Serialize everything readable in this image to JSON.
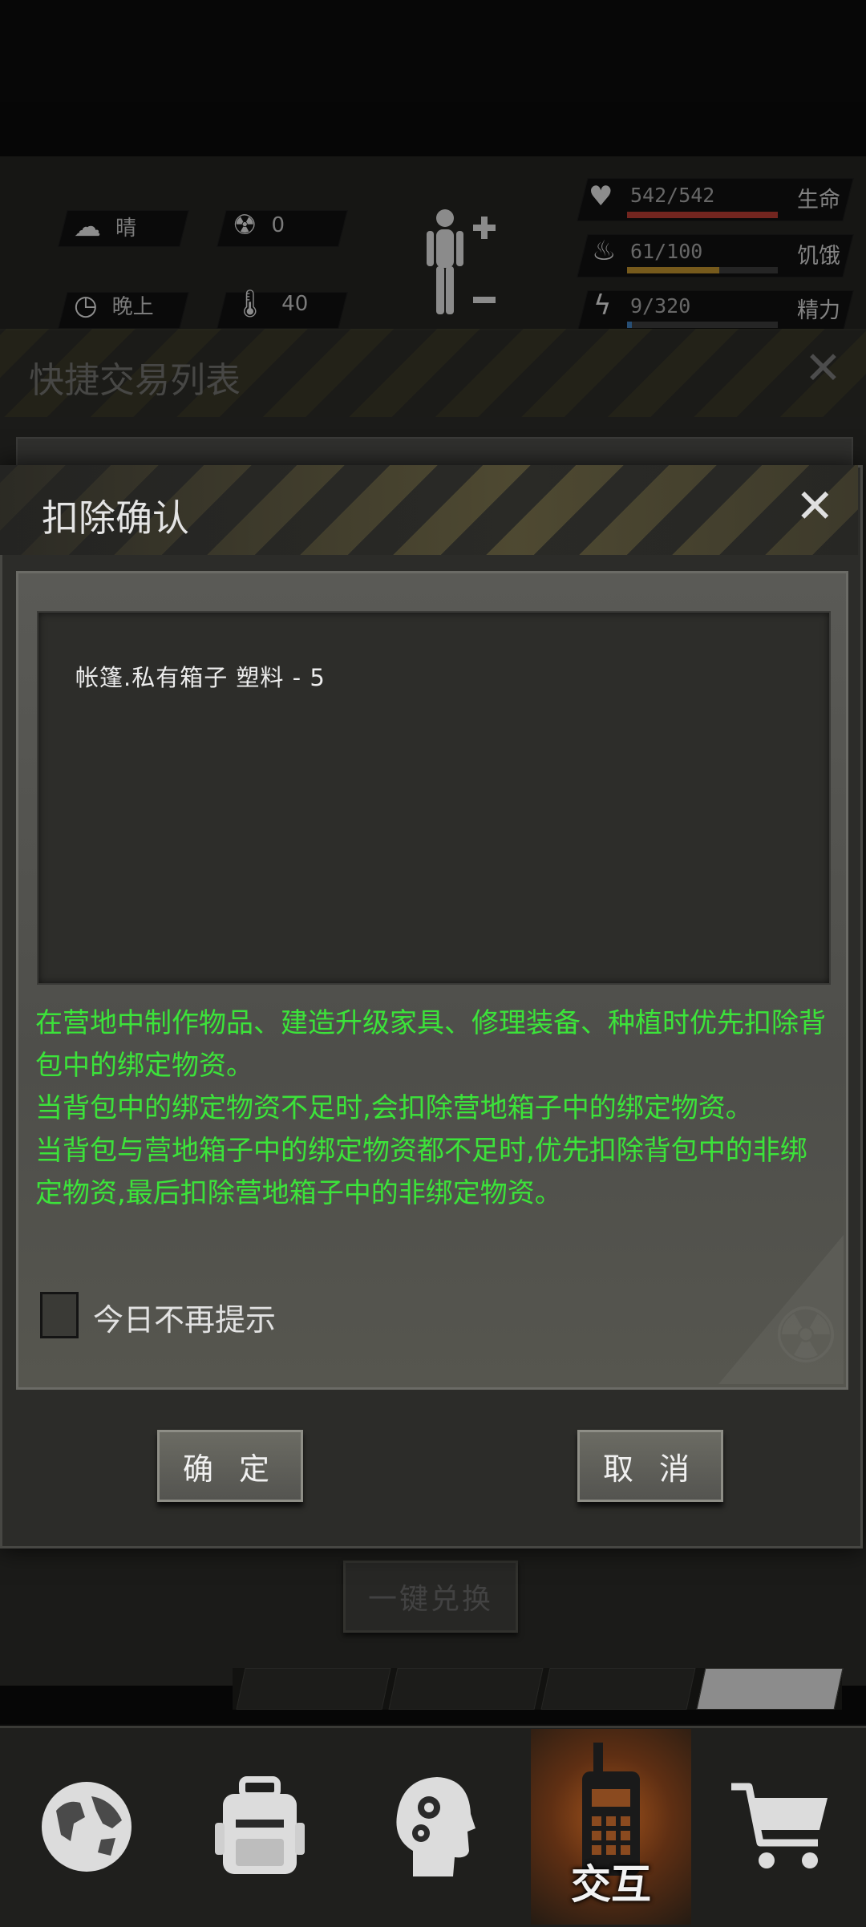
{
  "status": {
    "weather": "晴",
    "radiation": "0",
    "time_of_day": "晚上",
    "temperature": "40",
    "health": {
      "value": "542/542",
      "label": "生命",
      "ratio": 1.0,
      "color": "#b03a31"
    },
    "hunger": {
      "value": "61/100",
      "label": "饥饿",
      "ratio": 0.61,
      "color": "#b58a2c"
    },
    "energy": {
      "value": "9/320",
      "label": "精力",
      "ratio": 0.03,
      "color": "#3c78b3"
    }
  },
  "trade_panel": {
    "title": "快捷交易列表",
    "exchange_button": "一键兑换"
  },
  "dialog": {
    "title": "扣除确认",
    "items_text": "帐篷.私有箱子 塑料 - 5",
    "notice": [
      "在营地中制作物品、建造升级家具、修理装备、种植时优先扣除背包中的绑定物资。",
      "当背包中的绑定物资不足时,会扣除营地箱子中的绑定物资。",
      "当背包与营地箱子中的绑定物资都不足时,优先扣除背包中的非绑定物资,最后扣除营地箱子中的非绑定物资。"
    ],
    "checkbox_label": "今日不再提示",
    "checkbox_checked": false,
    "confirm_button": "确 定",
    "cancel_button": "取 消",
    "notice_color": "#3ce33a"
  },
  "nav": {
    "items": [
      {
        "name": "map",
        "icon": "globe-icon"
      },
      {
        "name": "backpack",
        "icon": "backpack-icon"
      },
      {
        "name": "skills",
        "icon": "head-gears-icon"
      },
      {
        "name": "interact",
        "icon": "walkie-talkie-icon",
        "label": "交互",
        "active": true
      },
      {
        "name": "shop",
        "icon": "cart-icon"
      }
    ]
  }
}
